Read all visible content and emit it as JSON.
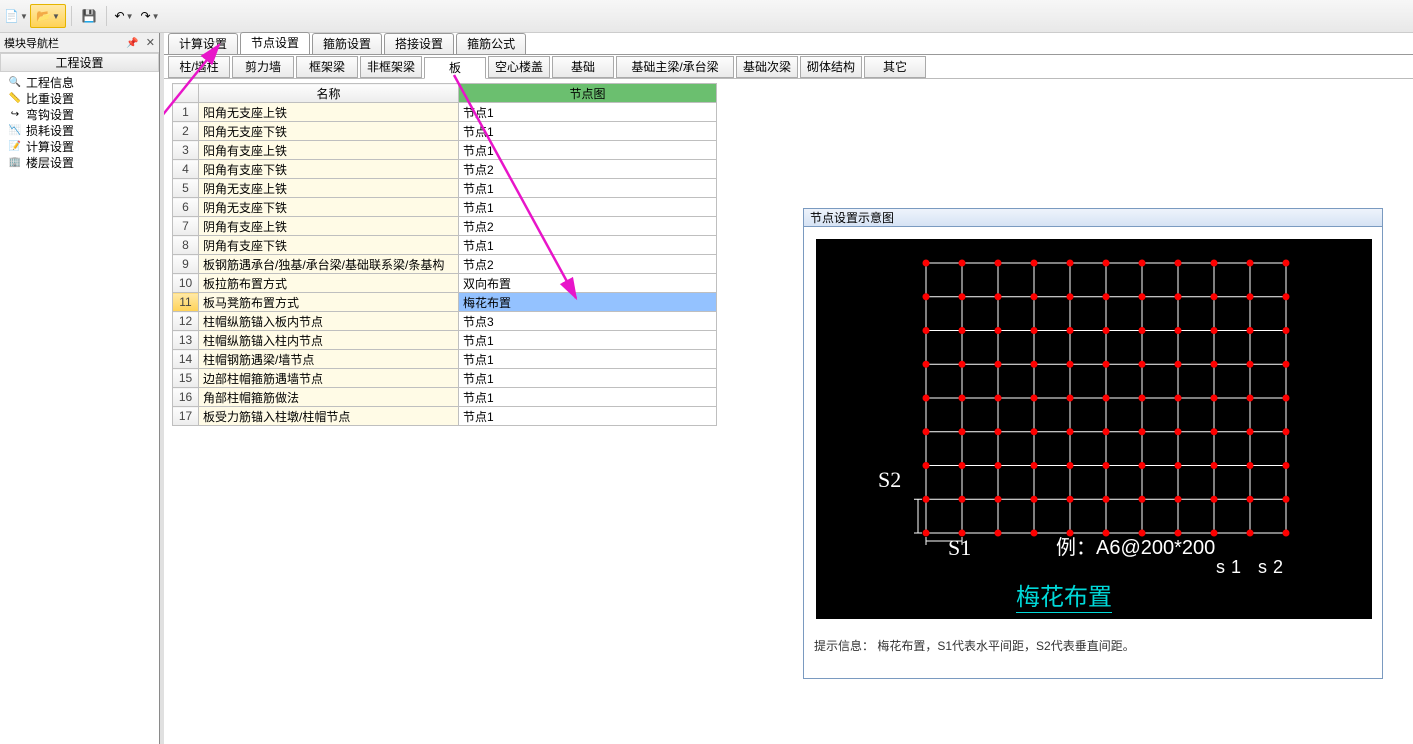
{
  "toolbar": {
    "new": "新建",
    "open": "打开",
    "save": "保存",
    "undo": "撤销",
    "redo": "重做"
  },
  "sidebar": {
    "panel_title": "模块导航栏",
    "section_title": "工程设置",
    "items": [
      {
        "label": "工程信息"
      },
      {
        "label": "比重设置"
      },
      {
        "label": "弯钩设置"
      },
      {
        "label": "损耗设置"
      },
      {
        "label": "计算设置"
      },
      {
        "label": "楼层设置"
      }
    ]
  },
  "tabs": {
    "main": [
      {
        "label": "计算设置"
      },
      {
        "label": "节点设置"
      },
      {
        "label": "箍筋设置"
      },
      {
        "label": "搭接设置"
      },
      {
        "label": "箍筋公式"
      }
    ],
    "active_main": 1,
    "sub": [
      {
        "label": "柱/墙柱"
      },
      {
        "label": "剪力墙"
      },
      {
        "label": "框架梁"
      },
      {
        "label": "非框架梁"
      },
      {
        "label": "板"
      },
      {
        "label": "空心楼盖"
      },
      {
        "label": "基础"
      },
      {
        "label": "基础主梁/承台梁",
        "wide": true
      },
      {
        "label": "基础次梁"
      },
      {
        "label": "砌体结构"
      },
      {
        "label": "其它"
      }
    ],
    "active_sub": 4
  },
  "table": {
    "headers": {
      "name": "名称",
      "node": "节点图"
    },
    "rows": [
      {
        "n": "1",
        "name": "阳角无支座上铁",
        "val": "节点1"
      },
      {
        "n": "2",
        "name": "阳角无支座下铁",
        "val": "节点1"
      },
      {
        "n": "3",
        "name": "阳角有支座上铁",
        "val": "节点1"
      },
      {
        "n": "4",
        "name": "阳角有支座下铁",
        "val": "节点2"
      },
      {
        "n": "5",
        "name": "阴角无支座上铁",
        "val": "节点1"
      },
      {
        "n": "6",
        "name": "阴角无支座下铁",
        "val": "节点1"
      },
      {
        "n": "7",
        "name": "阴角有支座上铁",
        "val": "节点2"
      },
      {
        "n": "8",
        "name": "阴角有支座下铁",
        "val": "节点1"
      },
      {
        "n": "9",
        "name": "板钢筋遇承台/独基/承台梁/基础联系梁/条基构",
        "val": "节点2"
      },
      {
        "n": "10",
        "name": "板拉筋布置方式",
        "val": "双向布置"
      },
      {
        "n": "11",
        "name": "板马凳筋布置方式",
        "val": "梅花布置"
      },
      {
        "n": "12",
        "name": "柱帽纵筋锚入板内节点",
        "val": "节点3"
      },
      {
        "n": "13",
        "name": "柱帽纵筋锚入柱内节点",
        "val": "节点1"
      },
      {
        "n": "14",
        "name": "柱帽钢筋遇梁/墙节点",
        "val": "节点1"
      },
      {
        "n": "15",
        "name": "边部柱帽箍筋遇墙节点",
        "val": "节点1"
      },
      {
        "n": "16",
        "name": "角部柱帽箍筋做法",
        "val": "节点1"
      },
      {
        "n": "17",
        "name": "板受力筋锚入柱墩/柱帽节点",
        "val": "节点1"
      }
    ],
    "selected_row": 10
  },
  "diagram": {
    "title": "节点设置示意图",
    "s1": "S1",
    "s2": "S2",
    "example": "例：A6@200*200",
    "example_sub": "s1  s2",
    "title_cn": "梅花布置",
    "hint": "提示信息：  梅花布置，S1代表水平间距，S2代表垂直间距。",
    "grid_cols": 10,
    "grid_rows": 8
  },
  "icons": {
    "doc": "📄",
    "open": "📂",
    "save": "💾",
    "undo": "↶",
    "redo": "↷",
    "info": "🔍",
    "scale": "📏",
    "hook": "↪",
    "loss": "📉",
    "calc": "📝",
    "floor": "🏢"
  }
}
